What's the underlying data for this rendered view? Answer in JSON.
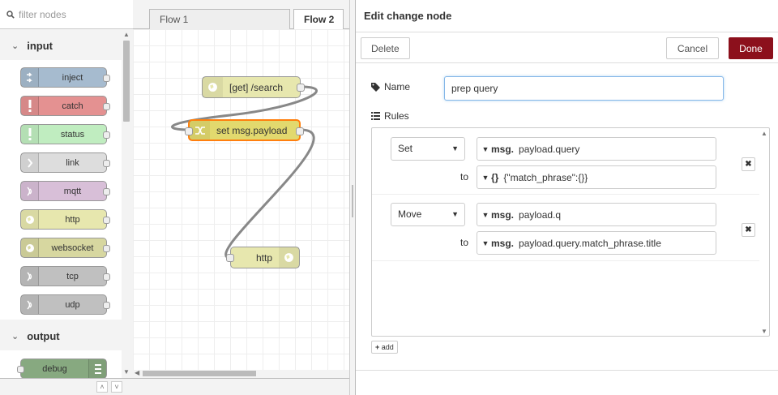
{
  "palette": {
    "filter_placeholder": "filter nodes",
    "categories": [
      {
        "label": "input",
        "nodes": [
          {
            "label": "inject",
            "color": "#a6bbcf",
            "icon": "inject-icon"
          },
          {
            "label": "catch",
            "color": "#e49191",
            "icon": "alert-icon"
          },
          {
            "label": "status",
            "color": "#c0edc0",
            "icon": "alert-icon"
          },
          {
            "label": "link",
            "color": "#dddddd",
            "icon": "link-icon"
          },
          {
            "label": "mqtt",
            "color": "#d8bfd8",
            "icon": "bridge-icon"
          },
          {
            "label": "http",
            "color": "#e7e7ae",
            "icon": "white-globe-icon"
          },
          {
            "label": "websocket",
            "color": "#d7d7a0",
            "icon": "white-globe-icon"
          },
          {
            "label": "tcp",
            "color": "#c0c0c0",
            "icon": "bridge-icon"
          },
          {
            "label": "udp",
            "color": "#c0c0c0",
            "icon": "bridge-icon"
          }
        ]
      },
      {
        "label": "output",
        "nodes": [
          {
            "label": "debug",
            "color": "#87a980",
            "icon": "debug-icon"
          }
        ]
      }
    ]
  },
  "workspace": {
    "tabs": [
      {
        "label": "Flow 1",
        "active": false
      },
      {
        "label": "Flow 2",
        "active": true
      }
    ],
    "nodes": {
      "get_search": {
        "label": "[get] /search",
        "color": "#e7e7ae"
      },
      "set_payload": {
        "label": "set msg.payload",
        "color": "#e2d96e"
      },
      "http_out": {
        "label": "http",
        "color": "#e7e7ae"
      }
    }
  },
  "editor": {
    "title": "Edit change node",
    "delete_label": "Delete",
    "cancel_label": "Cancel",
    "done_label": "Done",
    "name_label": "Name",
    "name_value": "prep query",
    "rules_label": "Rules",
    "rules": [
      {
        "action": "Set",
        "target_prefix": "msg.",
        "target": "payload.query",
        "to_label": "to",
        "value_prefix": "{}",
        "value": "{\"match_phrase\":{}}"
      },
      {
        "action": "Move",
        "target_prefix": "msg.",
        "target": "payload.q",
        "to_label": "to",
        "value_prefix": "msg.",
        "value": "payload.query.match_phrase.title"
      }
    ],
    "add_label": "add"
  }
}
